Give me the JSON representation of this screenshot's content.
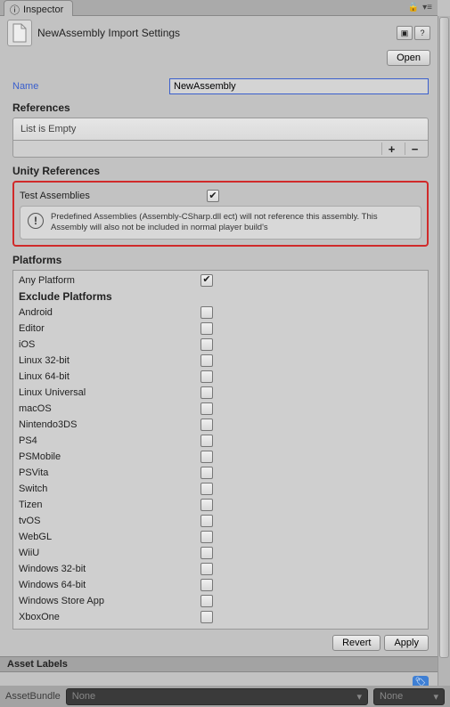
{
  "tab": {
    "title": "Inspector"
  },
  "header": {
    "title": "NewAssembly Import Settings",
    "open_label": "Open"
  },
  "name_field": {
    "label": "Name",
    "value": "NewAssembly"
  },
  "references": {
    "header": "References",
    "empty_text": "List is Empty"
  },
  "unity_refs": {
    "header": "Unity References",
    "test_label": "Test Assemblies",
    "test_checked": true,
    "info_text": "Predefined Assemblies (Assembly-CSharp.dll ect) will not reference this assembly. This Assembly will also not be included in normal player build's"
  },
  "platforms": {
    "header": "Platforms",
    "any_label": "Any Platform",
    "any_checked": true,
    "exclude_header": "Exclude Platforms",
    "items": [
      {
        "label": "Android",
        "checked": false
      },
      {
        "label": "Editor",
        "checked": false
      },
      {
        "label": "iOS",
        "checked": false
      },
      {
        "label": "Linux 32-bit",
        "checked": false
      },
      {
        "label": "Linux 64-bit",
        "checked": false
      },
      {
        "label": "Linux Universal",
        "checked": false
      },
      {
        "label": "macOS",
        "checked": false
      },
      {
        "label": "Nintendo3DS",
        "checked": false
      },
      {
        "label": "PS4",
        "checked": false
      },
      {
        "label": "PSMobile",
        "checked": false
      },
      {
        "label": "PSVita",
        "checked": false
      },
      {
        "label": "Switch",
        "checked": false
      },
      {
        "label": "Tizen",
        "checked": false
      },
      {
        "label": "tvOS",
        "checked": false
      },
      {
        "label": "WebGL",
        "checked": false
      },
      {
        "label": "WiiU",
        "checked": false
      },
      {
        "label": "Windows 32-bit",
        "checked": false
      },
      {
        "label": "Windows 64-bit",
        "checked": false
      },
      {
        "label": "Windows Store App",
        "checked": false
      },
      {
        "label": "XboxOne",
        "checked": false
      }
    ]
  },
  "footer": {
    "revert": "Revert",
    "apply": "Apply"
  },
  "asset_labels": {
    "header": "Asset Labels"
  },
  "bundle": {
    "label": "AssetBundle",
    "value1": "None",
    "value2": "None"
  }
}
